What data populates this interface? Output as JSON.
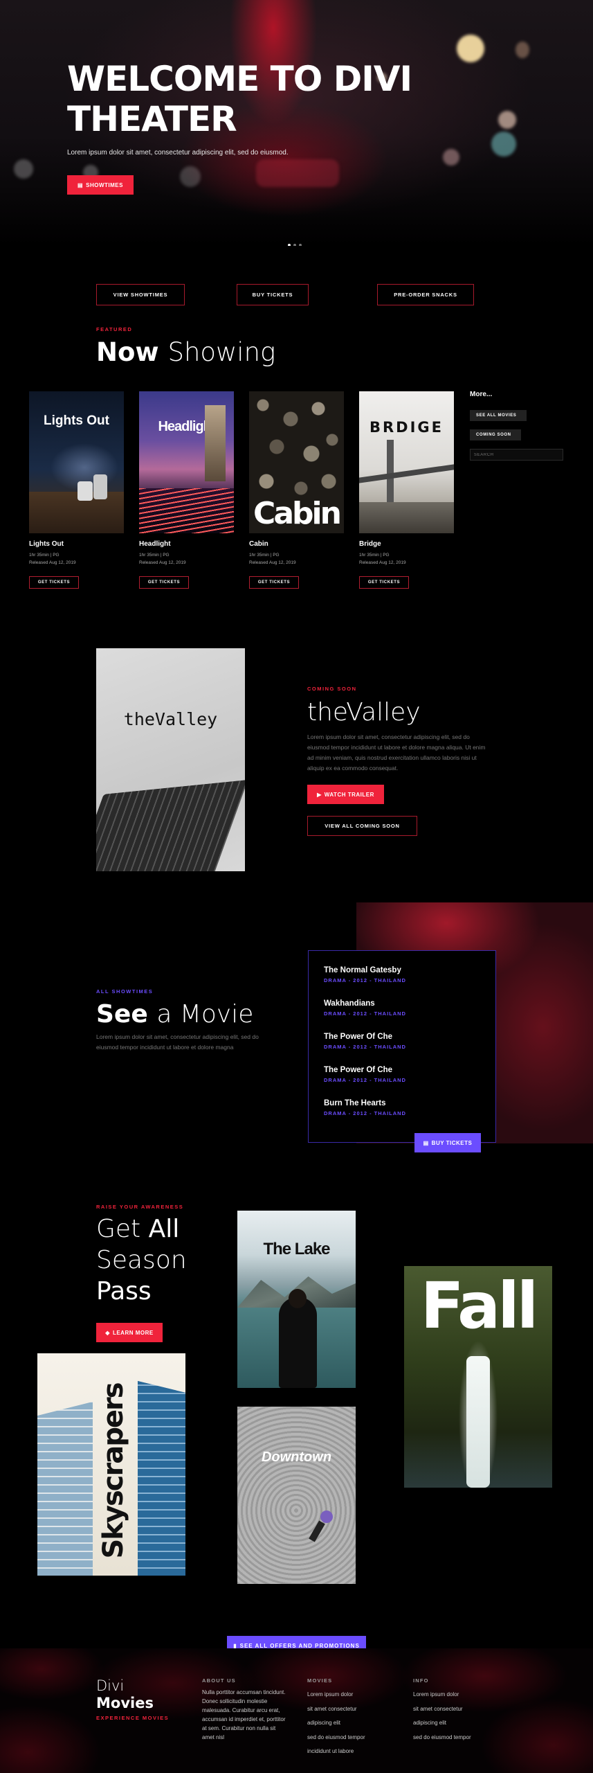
{
  "hero": {
    "title_line1": "WELCOME TO DIVI",
    "title_line2": "THEATER",
    "subtitle": "Lorem ipsum dolor sit amet, consectetur adipiscing elit, sed do eiusmod.",
    "button_label": "SHOWTIMES",
    "button_icon": "ticket-icon",
    "slides_count": 3,
    "active_slide": 1
  },
  "quick_links": [
    "VIEW SHOWTIMES",
    "BUY TICKETS",
    "PRE-ORDER SNACKS"
  ],
  "now_showing": {
    "kicker": "FEATURED",
    "title_bold": "Now",
    "title_light": "Showing",
    "movies": [
      {
        "poster_text": "Lights Out",
        "name": "Lights Out",
        "meta1": "1hr 35min | PG",
        "meta2": "Released Aug 12, 2019",
        "button": "GET TICKETS"
      },
      {
        "poster_text": "Headlight",
        "name": "Headlight",
        "meta1": "1hr 35min | PG",
        "meta2": "Released Aug 12, 2019",
        "button": "GET TICKETS"
      },
      {
        "poster_text": "Cabin",
        "name": "Cabin",
        "meta1": "1hr 35min | PG",
        "meta2": "Released Aug 12, 2019",
        "button": "GET TICKETS"
      },
      {
        "poster_text": "BRDIGE",
        "name": "Bridge",
        "meta1": "1hr 35min | PG",
        "meta2": "Released Aug 12, 2019",
        "button": "GET TICKETS"
      }
    ],
    "more": {
      "heading": "More...",
      "see_all": "SEE ALL MOVIES",
      "coming_soon": "COMING SOON",
      "search_placeholder": "SEARCH"
    }
  },
  "coming_soon": {
    "poster_text": "theValley",
    "kicker": "COMING SOON",
    "title": "theValley",
    "body": "Lorem ipsum dolor sit amet, consectetur adipiscing elit, sed do eiusmod tempor incididunt ut labore et dolore magna aliqua. Ut enim ad minim veniam, quis nostrud exercitation ullamco laboris nisi ut aliquip ex ea commodo consequat.",
    "trailer_button": "WATCH TRAILER",
    "trailer_icon": "play-icon",
    "all_button": "VIEW ALL COMING SOON"
  },
  "showtimes": {
    "kicker": "ALL SHOWTIMES",
    "title_bold": "See",
    "title_light": "a Movie",
    "body": "Lorem ipsum dolor sit amet, consectetur adipiscing elit, sed do eiusmod tempor incididunt ut labore et dolore magna",
    "list": [
      {
        "title": "The Normal Gatesby",
        "meta": "DRAMA - 2012 - THAILAND"
      },
      {
        "title": "Wakhandians",
        "meta": "DRAMA - 2012 - THAILAND"
      },
      {
        "title": "The Power Of Che",
        "meta": "DRAMA - 2012 - THAILAND"
      },
      {
        "title": "The Power Of Che",
        "meta": "DRAMA - 2012 - THAILAND"
      },
      {
        "title": "Burn The Hearts",
        "meta": "DRAMA - 2012 - THAILAND"
      }
    ],
    "buy_button": "BUY TICKETS",
    "buy_icon": "ticket-icon"
  },
  "season_pass": {
    "kicker": "RAISE YOUR AWARENESS",
    "line1_light": "Get",
    "line1_bold": "All",
    "line2": "Season",
    "line3": "Pass",
    "button": "LEARN MORE",
    "button_icon": "tag-icon",
    "posters": {
      "lake": "The Lake",
      "downtown": "Downtown",
      "fall": "Fall",
      "skyscrapers": "Skyscrapers"
    }
  },
  "offers_button": "SEE ALL OFFERS AND PROMOTIONS",
  "offers_icon": "bookmark-icon",
  "footer": {
    "brand_line1": "Divi",
    "brand_line2": "Movies",
    "brand_tag": "EXPERIENCE MOVIES",
    "about": {
      "heading": "ABOUT US",
      "text": "Nulla porttitor accumsan tincidunt. Donec sollicitudin molestie malesuada. Curabitur arcu erat, accumsan id imperdiet et, porttitor at sem. Curabitur non nulla sit amet nisl"
    },
    "movies": {
      "heading": "MOVIES",
      "items": [
        "Lorem ipsum dolor",
        "sit amet consectetur",
        "adipiscing elit",
        "sed do eiusmod tempor",
        "incididunt ut labore"
      ]
    },
    "info": {
      "heading": "INFO",
      "items": [
        "Lorem ipsum dolor",
        "sit amet consectetur",
        "adipiscing elit",
        "sed do eiusmod tempor"
      ]
    }
  },
  "colors": {
    "accent_red": "#f0233b",
    "accent_purple": "#6b4dff",
    "background": "#000000"
  }
}
